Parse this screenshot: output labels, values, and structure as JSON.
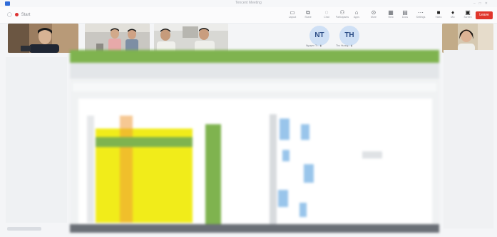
{
  "window": {
    "title": "Tencent Meeting"
  },
  "recording": {
    "label": "Start"
  },
  "toolbar": {
    "items": [
      {
        "icon": "screen-icon",
        "label": "Layout"
      },
      {
        "icon": "share-icon",
        "label": "Share"
      },
      {
        "icon": "chat-icon",
        "label": "Chat"
      },
      {
        "icon": "participants-icon",
        "label": "Participants"
      },
      {
        "icon": "apps-icon",
        "label": "Apps"
      },
      {
        "icon": "more-icon",
        "label": "More"
      },
      {
        "icon": "grid-icon",
        "label": "View"
      },
      {
        "icon": "doc-icon",
        "label": "Docs"
      },
      {
        "icon": "settings-icon",
        "label": "Settings"
      },
      {
        "icon": "camera-icon",
        "label": "Video"
      },
      {
        "icon": "mic-icon",
        "label": "Mic"
      },
      {
        "icon": "monitor-icon",
        "label": "Screen"
      }
    ],
    "leave_label": "Leave"
  },
  "participants": [
    {
      "initials": "NT",
      "name": "Nguyen Tr..."
    },
    {
      "initials": "TH",
      "name": "Thu Huong..."
    }
  ],
  "colors": {
    "accent": "#2f6bd8",
    "leave": "#e0362c",
    "avatar_bg": "#cfe0f5",
    "sheet_header": "#7fb34f",
    "highlight_yellow": "#f1ec1a"
  }
}
